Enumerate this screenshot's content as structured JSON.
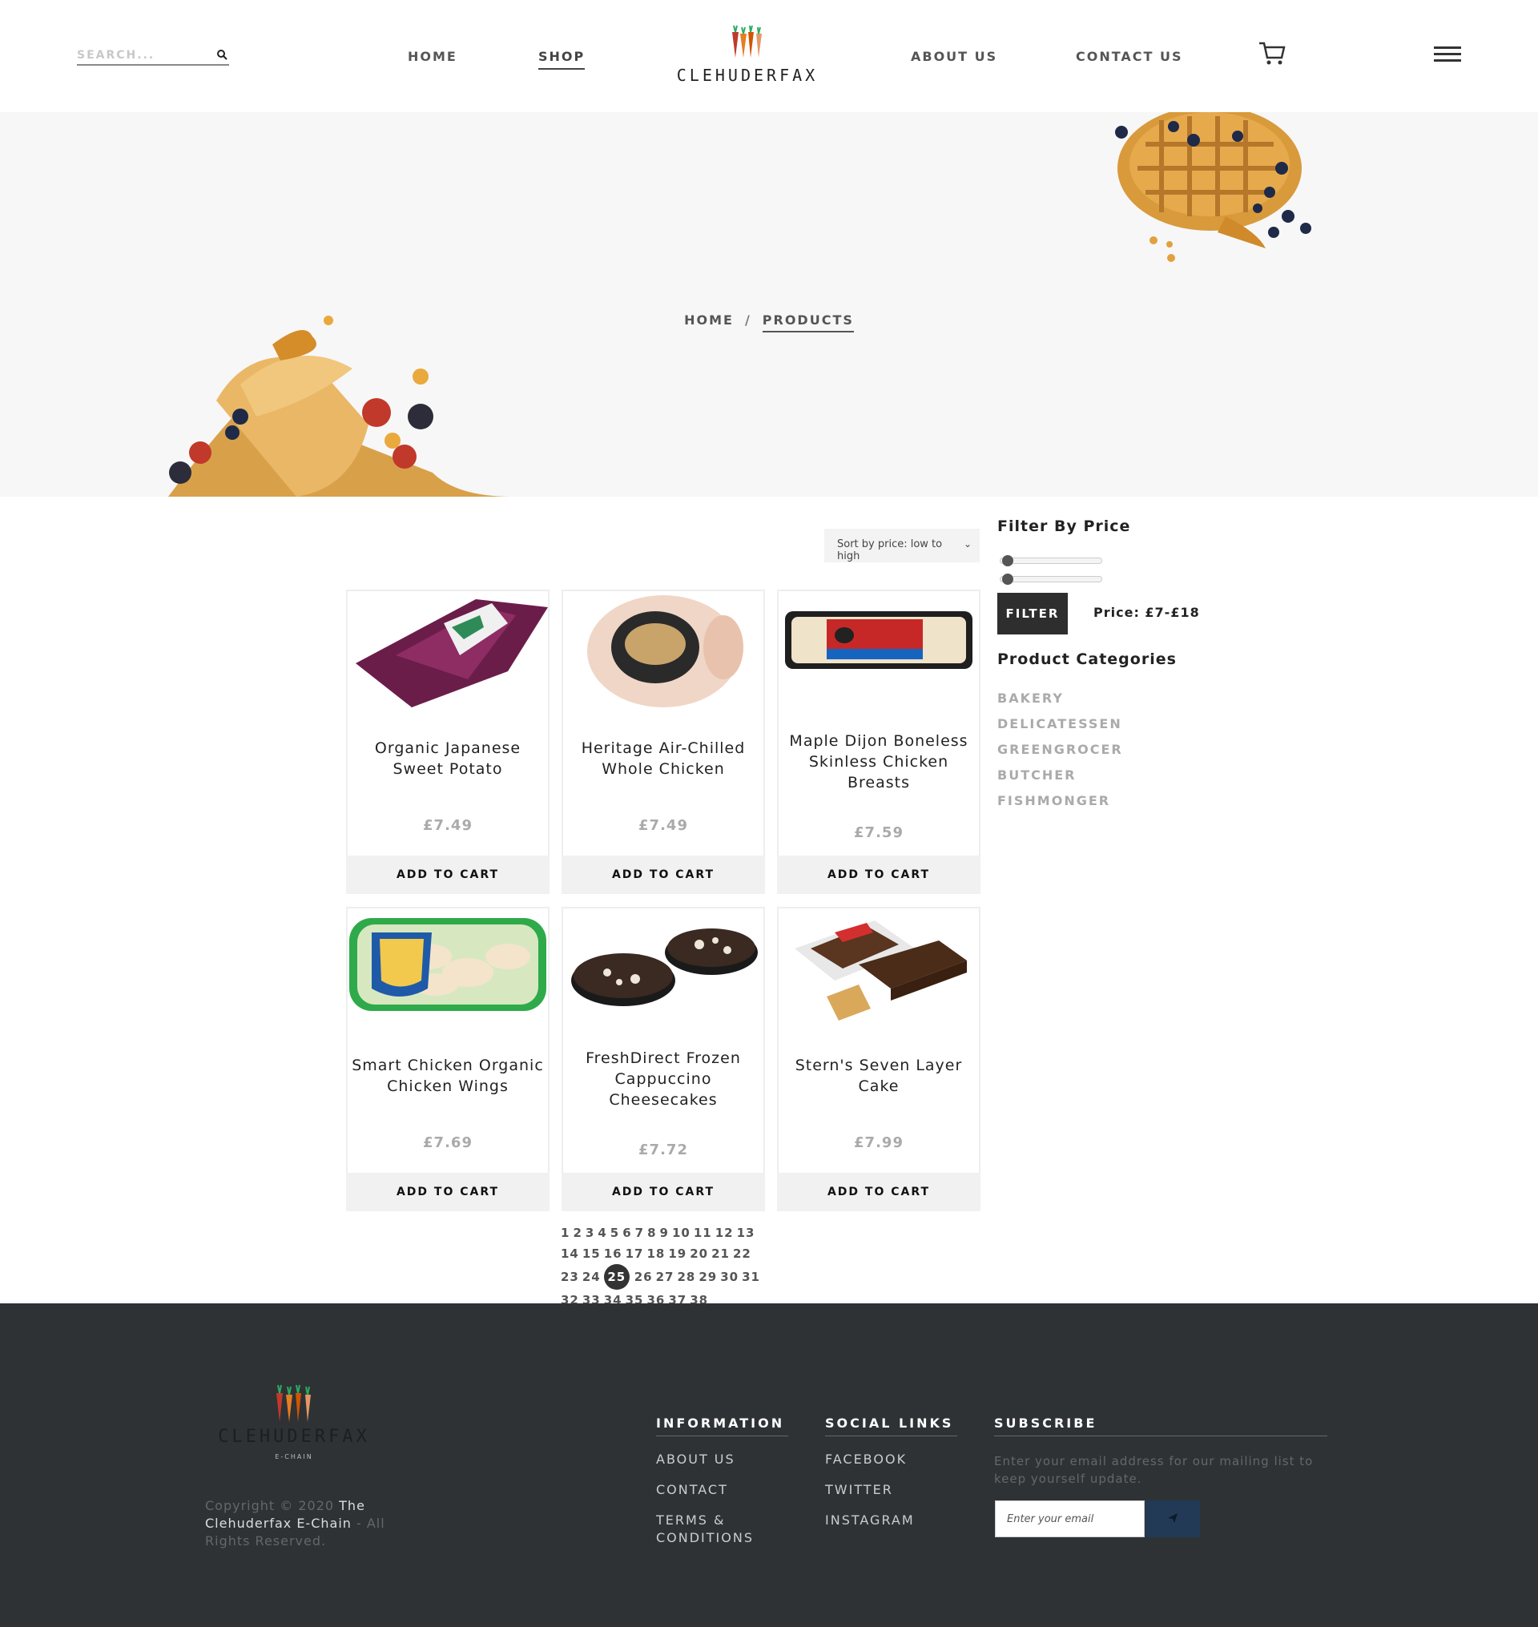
{
  "header": {
    "search_placeholder": "SEARCH...",
    "nav": {
      "home": "HOME",
      "shop": "SHOP",
      "about": "ABOUT US",
      "contact": "CONTACT US"
    },
    "logo_text": "CLEHUDERFAX"
  },
  "hero": {
    "breadcrumb": {
      "home": "HOME",
      "separator": "/",
      "current": "PRODUCTS"
    }
  },
  "toolbar": {
    "sort_label": "Sort by price: low to high"
  },
  "products": [
    {
      "title": "Organic Japanese Sweet Potato",
      "price": "£7.49",
      "cta": "ADD TO CART"
    },
    {
      "title": "Heritage Air-Chilled Whole Chicken",
      "price": "£7.49",
      "cta": "ADD TO CART"
    },
    {
      "title": "Maple Dijon Boneless Skinless Chicken Breasts",
      "price": "£7.59",
      "cta": "ADD TO CART"
    },
    {
      "title": "Smart Chicken Organic Chicken Wings",
      "price": "£7.69",
      "cta": "ADD TO CART"
    },
    {
      "title": "FreshDirect Frozen Cappuccino Cheesecakes",
      "price": "£7.72",
      "cta": "ADD TO CART"
    },
    {
      "title": "Stern's Seven Layer Cake",
      "price": "£7.99",
      "cta": "ADD TO CART"
    }
  ],
  "pagination": {
    "pages": [
      "1",
      "2",
      "3",
      "4",
      "5",
      "6",
      "7",
      "8",
      "9",
      "10",
      "11",
      "12",
      "13",
      "14",
      "15",
      "16",
      "17",
      "18",
      "19",
      "20",
      "21",
      "22",
      "23",
      "24",
      "25",
      "26",
      "27",
      "28",
      "29",
      "30",
      "31",
      "32",
      "33",
      "34",
      "35",
      "36",
      "37",
      "38"
    ],
    "current": "25"
  },
  "sidebar": {
    "filter_heading": "Filter By Price",
    "filter_button": "FILTER",
    "price_range": "Price: £7-£18",
    "categories_heading": "Product Categories",
    "categories": [
      "BAKERY",
      "DELICATESSEN",
      "GREENGROCER",
      "BUTCHER",
      "FISHMONGER"
    ]
  },
  "footer": {
    "logo_text": "CLEHUDERFAX",
    "logo_sub": "E-CHAIN",
    "copyright_prefix": "Copyright © 2020 ",
    "copyright_brand": "The Clehuderfax E-Chain",
    "copyright_suffix": " - All Rights Reserved.",
    "information": {
      "heading": "INFORMATION",
      "links": [
        "ABOUT US",
        "CONTACT",
        "TERMS & CONDITIONS"
      ]
    },
    "social": {
      "heading": "SOCIAL LINKS",
      "links": [
        "FACEBOOK",
        "TWITTER",
        "INSTAGRAM"
      ]
    },
    "subscribe": {
      "heading": "SUBSCRIBE",
      "description": "Enter your email address for our mailing list to keep yourself update.",
      "placeholder": "Enter your email"
    }
  },
  "colors": {
    "footer_bg": "#2f3235",
    "hero_bg": "#f7f7f7",
    "button_dark": "#2e2e2e",
    "subscribe_button": "#223a55"
  }
}
